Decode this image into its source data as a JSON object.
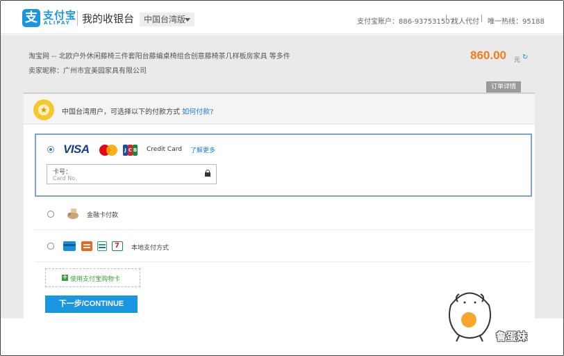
{
  "header": {
    "logo_glyph": "支",
    "logo_name": "支付宝",
    "logo_sub": "ALIPAY",
    "title": "我的收银台",
    "region": "中国台湾版",
    "account_label": "支付宝账户：886-937531507",
    "proxy_pay": "找人代付",
    "hotline": "唯一热线：95188"
  },
  "order": {
    "title": "淘宝网 -- 北欧户外休闲藤椅三件套阳台藤编桌椅组合创意藤椅茶几样板房家具 等多件",
    "seller": "卖家昵称：广州市宜美园家具有限公司",
    "amount": "860.00",
    "currency": "元",
    "detail_tab": "订单详情"
  },
  "notice": {
    "text": "中国台湾用户，可选择以下的付款方式",
    "link": "如何付款?"
  },
  "credit_card": {
    "visa": "VISA",
    "jcb": [
      "J",
      "C",
      "B"
    ],
    "label": "Credit Card",
    "learn_more": "了解更多",
    "card_label_cn": "卡号：",
    "card_label_en": "Card No."
  },
  "options": {
    "bank_card": "金融卡付款",
    "local_pay": "本地支付方式",
    "seven_eleven": "7"
  },
  "gift_card": {
    "plus": "+",
    "label": "使用支付宝购物卡"
  },
  "continue_label": "下一步/CONTINUE",
  "watermark": "鲁蛋妹",
  "colors": {
    "brand_blue": "#1a96e0",
    "amount_orange": "#f07c1e",
    "green": "#3aa33a"
  }
}
